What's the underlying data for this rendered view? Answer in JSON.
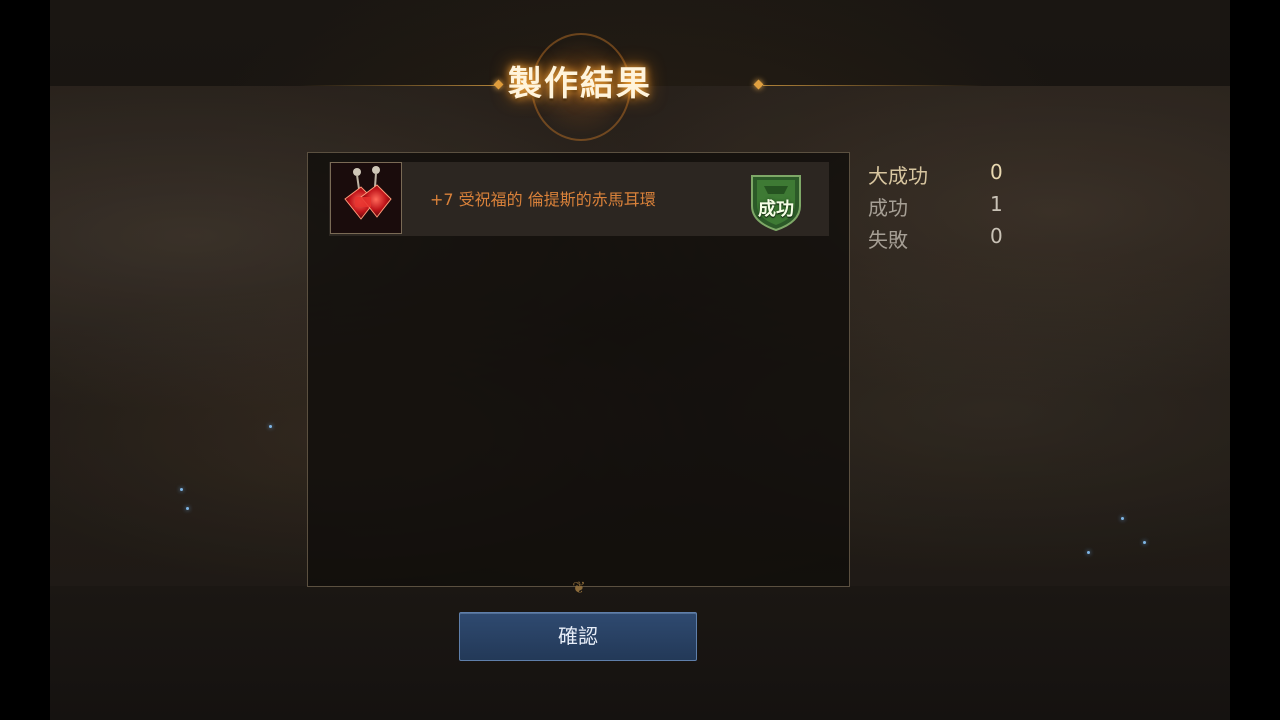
{
  "dialog": {
    "title": "製作結果"
  },
  "results": [
    {
      "item_name": "+7 受祝福的 倫提斯的赤馬耳環",
      "item_icon": "ruby-earrings-icon",
      "status": "成功",
      "status_color": "#3e7a34",
      "name_color": "#d9813a"
    }
  ],
  "summary": {
    "great_success_label": "大成功",
    "great_success_count": "0",
    "success_label": "成功",
    "success_count": "1",
    "fail_label": "失敗",
    "fail_count": "0"
  },
  "buttons": {
    "confirm_label": "確認"
  },
  "colors": {
    "title_glow": "#ffb040",
    "confirm_button": "#2f4a70"
  }
}
